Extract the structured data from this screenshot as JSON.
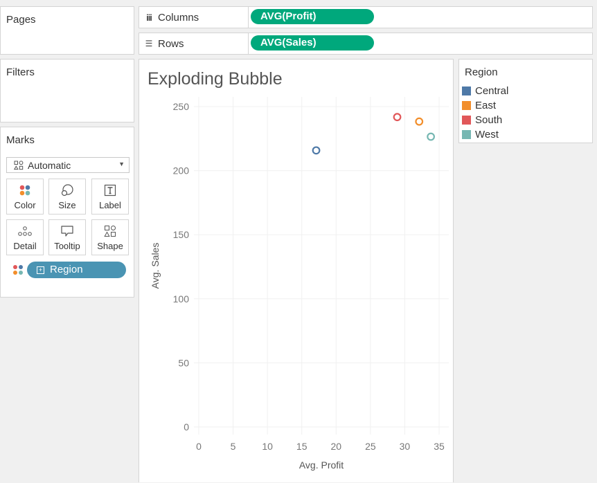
{
  "shelves": {
    "pages_title": "Pages",
    "filters_title": "Filters",
    "columns": {
      "label": "Columns",
      "icon": "columns-icon",
      "pill": "AVG(Profit)"
    },
    "rows": {
      "label": "Rows",
      "icon": "rows-icon",
      "pill": "AVG(Sales)"
    }
  },
  "marks": {
    "title": "Marks",
    "type": "Automatic",
    "buttons": [
      {
        "label": "Color",
        "icon": "color-icon"
      },
      {
        "label": "Size",
        "icon": "size-icon"
      },
      {
        "label": "Label",
        "icon": "label-icon"
      },
      {
        "label": "Detail",
        "icon": "detail-icon"
      },
      {
        "label": "Tooltip",
        "icon": "tooltip-icon"
      },
      {
        "label": "Shape",
        "icon": "shape-icon"
      }
    ],
    "region_pill": "Region"
  },
  "legend": {
    "title": "Region",
    "items": [
      {
        "name": "Central",
        "color": "#4e79a7"
      },
      {
        "name": "East",
        "color": "#f28e2b"
      },
      {
        "name": "South",
        "color": "#e15759"
      },
      {
        "name": "West",
        "color": "#76b7b2"
      }
    ]
  },
  "chart_data": {
    "type": "scatter",
    "title": "Exploding Bubble",
    "xlabel": "Avg. Profit",
    "ylabel": "Avg. Sales",
    "xlim": [
      0,
      35
    ],
    "ylim": [
      0,
      250
    ],
    "xticks": [
      0,
      5,
      10,
      15,
      20,
      25,
      30,
      35
    ],
    "yticks": [
      0,
      50,
      100,
      150,
      200,
      250
    ],
    "grid": true,
    "series": [
      {
        "name": "Central",
        "color": "#4e79a7",
        "x": 17.1,
        "y": 215.8
      },
      {
        "name": "East",
        "color": "#f28e2b",
        "x": 32.1,
        "y": 238.3
      },
      {
        "name": "South",
        "color": "#e15759",
        "x": 28.9,
        "y": 241.8
      },
      {
        "name": "West",
        "color": "#76b7b2",
        "x": 33.8,
        "y": 226.5
      }
    ]
  }
}
